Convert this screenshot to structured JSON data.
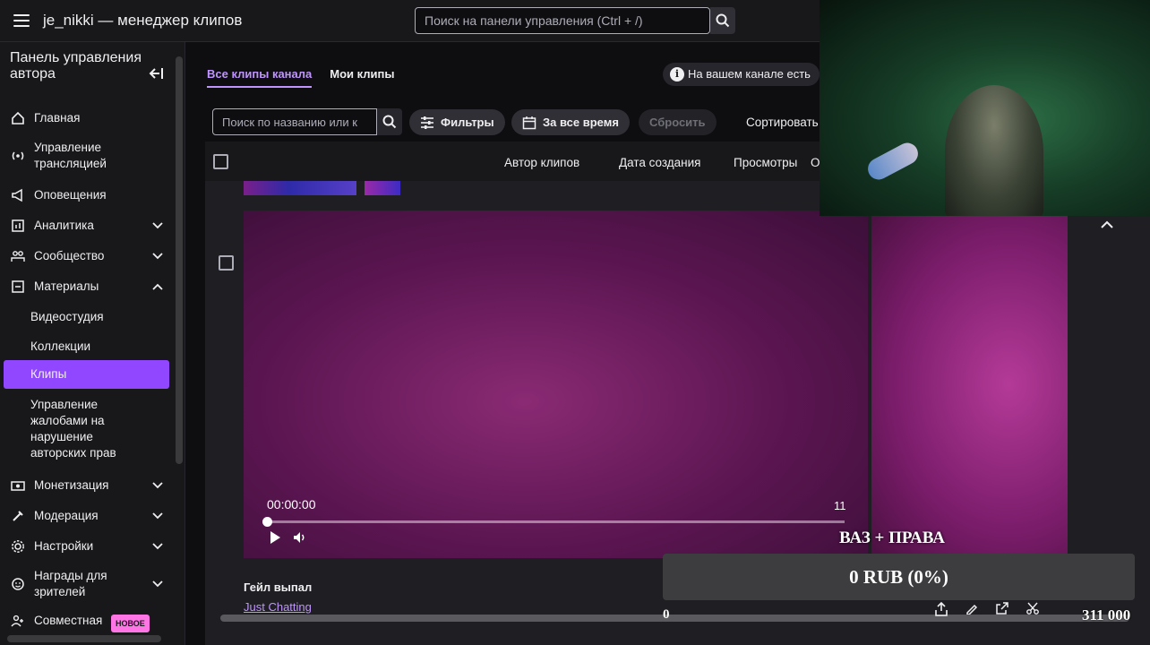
{
  "header": {
    "title": "je_nikki — менеджер клипов",
    "search_placeholder": "Поиск на панели управления (Ctrl + /)"
  },
  "sidebar": {
    "title": "Панель управления автора",
    "items": [
      {
        "label": "Главная",
        "icon": "home-icon"
      },
      {
        "label": "Управление трансляцией",
        "icon": "broadcast-icon"
      },
      {
        "label": "Оповещения",
        "icon": "megaphone-icon"
      },
      {
        "label": "Аналитика",
        "icon": "analytics-icon"
      },
      {
        "label": "Сообщество",
        "icon": "community-icon"
      },
      {
        "label": "Материалы",
        "icon": "content-icon"
      },
      {
        "label": "Монетизация",
        "icon": "monetization-icon"
      },
      {
        "label": "Модерация",
        "icon": "moderation-icon"
      },
      {
        "label": "Настройки",
        "icon": "gear-icon"
      },
      {
        "label": "Награды для зрителей",
        "icon": "rewards-icon"
      },
      {
        "label": "Совместная",
        "icon": "collab-icon",
        "badge": "НОВОЕ"
      }
    ],
    "sub_items": [
      {
        "label": "Видеостудия"
      },
      {
        "label": "Коллекции"
      },
      {
        "label": "Клипы"
      },
      {
        "label": "Управление жалобами на нарушение авторских прав"
      }
    ]
  },
  "tabs": [
    {
      "label": "Все клипы канала"
    },
    {
      "label": "Мои клипы"
    }
  ],
  "info_text": "На вашем канале есть",
  "toolbar": {
    "search_placeholder": "Поиск по названию или к",
    "filters": "Фильтры",
    "period": "За все время",
    "reset": "Сбросить",
    "sort": "Сортировать"
  },
  "table": {
    "columns": [
      "Автор клипов",
      "Дата создания",
      "Просмотры",
      "О"
    ]
  },
  "clip": {
    "time_current": "00:00:00",
    "time_right": "11",
    "title": "Гейл выпал",
    "game": "Just Chatting"
  },
  "donation": {
    "label": "ВАЗ + ПРАВА",
    "amount": "0 RUB (0%)",
    "min": "0",
    "max": "311 000",
    "progress": 0
  }
}
